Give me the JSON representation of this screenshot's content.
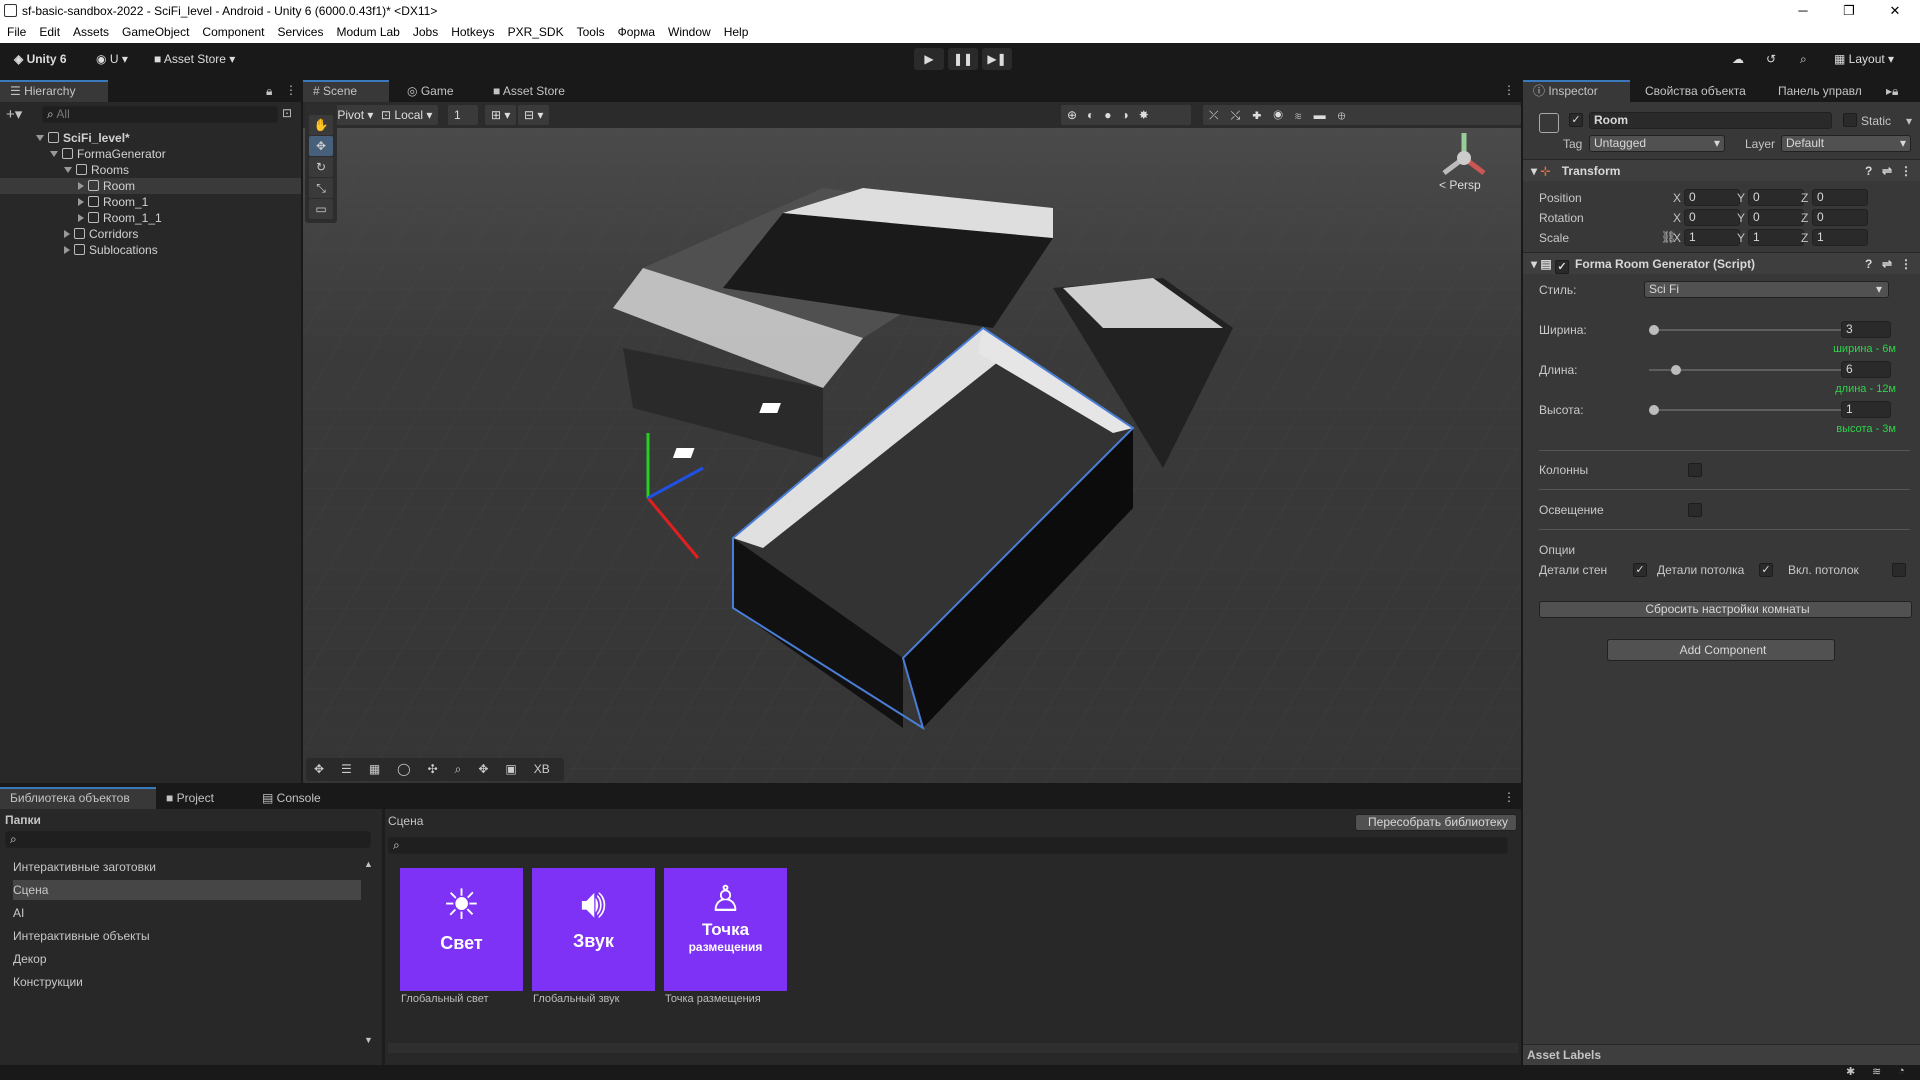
{
  "window": {
    "title": "sf-basic-sandbox-2022 - SciFi_level - Android - Unity 6 (6000.0.43f1)* <DX11>"
  },
  "menu": [
    "File",
    "Edit",
    "Assets",
    "GameObject",
    "Component",
    "Services",
    "Modum Lab",
    "Jobs",
    "Hotkeys",
    "PXR_SDK",
    "Tools",
    "Форма",
    "Window",
    "Help"
  ],
  "toolbar": {
    "account": "Unity 6",
    "user": "U",
    "asset_store": "Asset Store",
    "layout": "Layout"
  },
  "hierarchy": {
    "tab": "Hierarchy",
    "search_placeholder": "All",
    "items": [
      {
        "label": "SciFi_level*",
        "depth": 0,
        "bold": true
      },
      {
        "label": "FormaGenerator",
        "depth": 1
      },
      {
        "label": "Rooms",
        "depth": 2
      },
      {
        "label": "Room",
        "depth": 3,
        "selected": true
      },
      {
        "label": "Room_1",
        "depth": 3
      },
      {
        "label": "Room_1_1",
        "depth": 3
      },
      {
        "label": "Corridors",
        "depth": 2
      },
      {
        "label": "Sublocations",
        "depth": 2
      }
    ]
  },
  "scene": {
    "tabs": [
      "Scene",
      "Game",
      "Asset Store"
    ],
    "pivot": "Pivot",
    "local": "Local",
    "snap": "1",
    "persp": "< Persp",
    "overlay_last": "XB"
  },
  "inspector": {
    "tabs": [
      "Inspector",
      "Свойства объекта",
      "Панель управл"
    ],
    "object_name": "Room",
    "static": "Static",
    "tag_label": "Tag",
    "tag": "Untagged",
    "layer_label": "Layer",
    "layer": "Default",
    "transform": {
      "title": "Transform",
      "position": {
        "label": "Position",
        "x": "0",
        "y": "0",
        "z": "0"
      },
      "rotation": {
        "label": "Rotation",
        "x": "0",
        "y": "0",
        "z": "0"
      },
      "scale": {
        "label": "Scale",
        "x": "1",
        "y": "1",
        "z": "1"
      }
    },
    "script": {
      "title": "Forma Room Generator (Script)",
      "style_label": "Стиль:",
      "style": "Sci Fi",
      "width": {
        "label": "Ширина:",
        "value": "3",
        "note": "ширина - 6м",
        "fraction": 0.0
      },
      "length": {
        "label": "Длина:",
        "value": "6",
        "note": "длина - 12м",
        "fraction": 0.12
      },
      "height": {
        "label": "Высота:",
        "value": "1",
        "note": "высота - 3м",
        "fraction": 0.0
      },
      "columns": "Колонны",
      "lighting": "Освещение",
      "options": "Опции",
      "wall_details": "Детали стен",
      "ceiling_details": "Детали потолка",
      "ceiling_on": "Вкл. потолок",
      "reset": "Сбросить настройки комнаты"
    },
    "add_component": "Add Component",
    "asset_labels": "Asset Labels"
  },
  "bottom": {
    "tabs": [
      "Библиотека объектов",
      "Project",
      "Console"
    ],
    "folders_title": "Папки",
    "folders": [
      "Интерактивные заготовки",
      "Сцена",
      "AI",
      "Интерактивные объекты",
      "Декор",
      "Конструкции"
    ],
    "scene_title": "Сцена",
    "rebuild": "Пересобрать библиотеку",
    "cards": [
      {
        "title": "Свет",
        "caption": "Глобальный свет",
        "icon": "sun-icon"
      },
      {
        "title": "Звук",
        "caption": "Глобальный звук",
        "icon": "speaker-icon"
      },
      {
        "title": "Точка",
        "sub": "размещения",
        "caption": "Точка размещения",
        "icon": "person-icon"
      }
    ]
  }
}
